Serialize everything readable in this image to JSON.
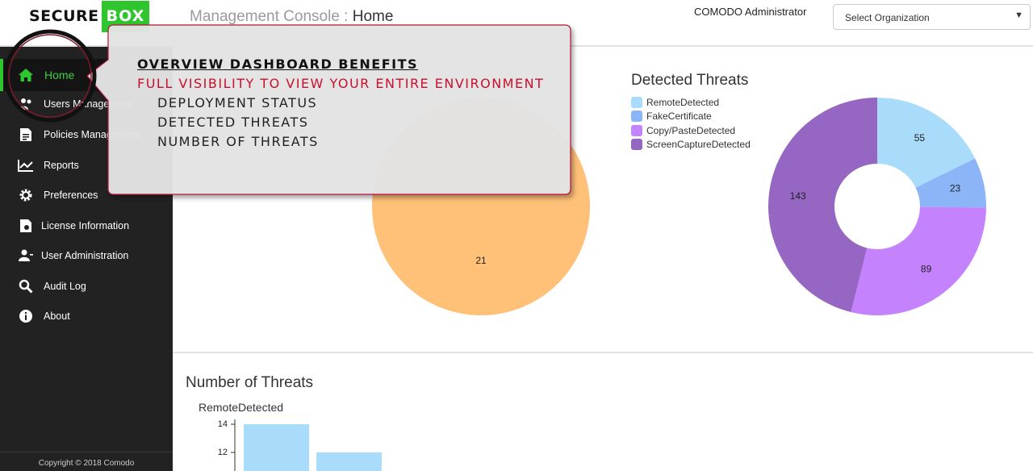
{
  "logo": {
    "part1": "SECURE",
    "part2": "BOX"
  },
  "header": {
    "console_label": "Management Console : ",
    "page": "Home",
    "user": "COMODO Administrator",
    "org_select": "Select Organization"
  },
  "sidebar": {
    "items": [
      {
        "label": "Home",
        "icon": "home-icon"
      },
      {
        "label": "Users Management",
        "icon": "users-icon"
      },
      {
        "label": "Policies Management",
        "icon": "policies-icon"
      },
      {
        "label": "Reports",
        "icon": "chart-icon"
      },
      {
        "label": "Preferences",
        "icon": "gear-icon"
      },
      {
        "label": "License Information",
        "icon": "license-icon"
      },
      {
        "label": "User Administration",
        "icon": "user-admin-icon"
      },
      {
        "label": "Audit Log",
        "icon": "search-icon"
      },
      {
        "label": "About",
        "icon": "info-icon"
      }
    ],
    "copyright": "Copyright © 2018 Comodo"
  },
  "deployment": {
    "value_label": "21"
  },
  "detected_threats": {
    "title": "Detected Threats",
    "legend": [
      {
        "label": "RemoteDetected"
      },
      {
        "label": "FakeCertificate"
      },
      {
        "label": "Copy/PasteDetected"
      },
      {
        "label": "ScreenCaptureDetected"
      }
    ]
  },
  "number_of_threats": {
    "title": "Number of Threats",
    "subtitle": "RemoteDetected"
  },
  "callout": {
    "title": "OVERVIEW DASHBOARD BENEFITS",
    "subtitle": "FULL VISIBILITY TO VIEW YOUR ENTIRE ENVIRONMENT",
    "items": [
      "DEPLOYMENT STATUS",
      "DETECTED THREATS",
      "NUMBER OF THREATS"
    ]
  },
  "colors": {
    "brand_green": "#2fc52f",
    "pie_orange": "#ffc078",
    "remote": "#a9dbfb",
    "fake": "#8cb5f8",
    "copy": "#c482fc",
    "screen": "#9667c2",
    "callout_red": "#c8102e"
  },
  "chart_data": [
    {
      "type": "pie",
      "categories": [
        ""
      ],
      "values": [
        21
      ]
    },
    {
      "type": "pie",
      "title": "Detected Threats",
      "categories": [
        "RemoteDetected",
        "FakeCertificate",
        "Copy/PasteDetected",
        "ScreenCaptureDetected"
      ],
      "values": [
        55,
        23,
        89,
        143
      ],
      "legend": "top-left"
    },
    {
      "type": "bar",
      "title": "Number of Threats",
      "ylabel": "RemoteDetected",
      "categories": [
        "",
        ""
      ],
      "values": [
        14,
        12
      ],
      "yticks": [
        12,
        14
      ]
    }
  ]
}
